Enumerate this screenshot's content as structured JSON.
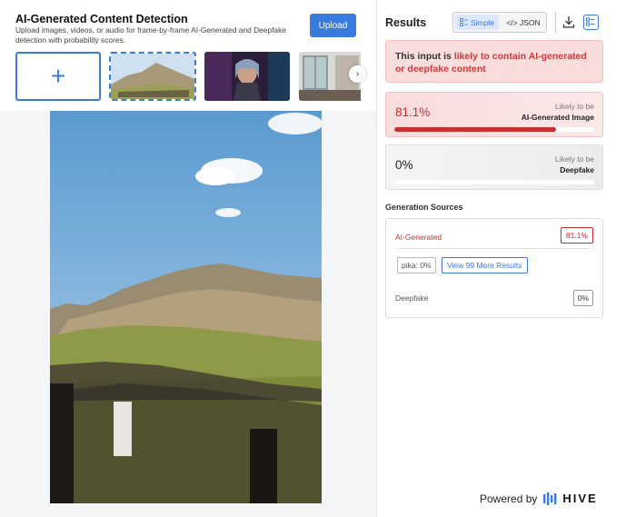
{
  "left": {
    "title": "AI-Generated Content Detection",
    "subtitle": "Upload images, videos, or audio for frame-by-frame AI-Generated and Deepfake detection with probability scores.",
    "upload_label": "Upload",
    "add_symbol": "+",
    "next_symbol": "›",
    "collapse_symbol": "⌃"
  },
  "results": {
    "title": "Results",
    "toggle_simple": "Simple",
    "toggle_json": "</> JSON",
    "verdict_prefix": "This input is ",
    "verdict_highlight": "likely to contain AI-generated or deepfake content",
    "ai_pct": "81.1%",
    "ai_fraction": 0.811,
    "ai_likely": "Likely to be",
    "ai_name": "AI-Generated Image",
    "df_pct": "0%",
    "df_fraction": 0,
    "df_likely": "Likely to be",
    "df_name": "Deepfake",
    "sources_title": "Generation Sources",
    "src_ai_label": "AI-Generated",
    "src_ai_pct": "81.1%",
    "pika_chip": "pika: 0%",
    "more_label": "View 99 More Results",
    "src_df_label": "Deepfake",
    "src_df_pct": "0%",
    "powered_by": "Powered by",
    "brand": "HIVE"
  },
  "colors": {
    "accent": "#3a7be0",
    "danger": "#c7302f"
  }
}
